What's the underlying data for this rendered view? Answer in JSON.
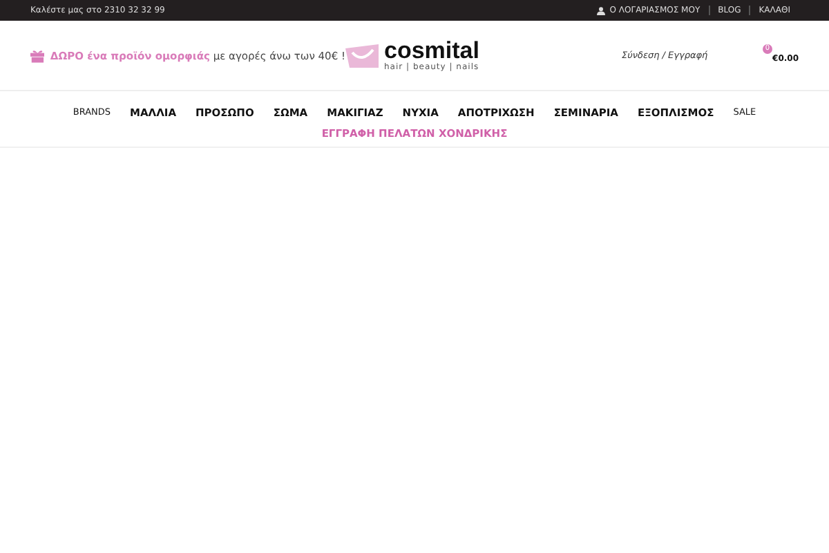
{
  "top_bar": {
    "phone_text": "Καλέστε μας στο 2310 32 32 99",
    "links": [
      {
        "label": "Ο ΛΟΓΑΡΙΑΣΜΟΣ ΜΟΥ",
        "kind": "account"
      },
      {
        "label": "BLOG",
        "kind": "plain"
      },
      {
        "label": "ΚΑΛΑΘΙ",
        "kind": "plain"
      }
    ]
  },
  "header": {
    "promo": "**ΔΩΡΟ ένα προϊόν ομορφιάς** με αγορές άνω των 40€ !",
    "logo": {
      "name": "cosmital",
      "tagline": "hair | beauty | nails"
    },
    "login": "Σύνδεση / Εγγραφή",
    "cart": {
      "count": "0",
      "total": "€0.00"
    }
  },
  "nav": {
    "items": [
      {
        "label": "BRANDS",
        "kind": "plain"
      },
      {
        "label": "ΜΑΛΛΙΑ",
        "kind": "bold"
      },
      {
        "label": "ΠΡΟΣΩΠΟ",
        "kind": "bold"
      },
      {
        "label": "ΣΩΜΑ",
        "kind": "bold"
      },
      {
        "label": "ΜΑΚΙΓΙΑΖ",
        "kind": "bold"
      },
      {
        "label": "ΝΥΧΙΑ",
        "kind": "bold"
      },
      {
        "label": "ΑΠΟΤΡΙΧΩΣΗ",
        "kind": "bold"
      },
      {
        "label": "ΣΕΜΙΝΑΡΙΑ",
        "kind": "bold"
      },
      {
        "label": "ΕΞΟΠΛΙΣΜΟΣ",
        "kind": "bold"
      },
      {
        "label": "SALE",
        "kind": "plain"
      }
    ],
    "wholesale": "ΕΓΓΡΑΦΗ ΠΕΛΑΤΩΝ ΧΟΝΔΡΙΚΗΣ"
  }
}
